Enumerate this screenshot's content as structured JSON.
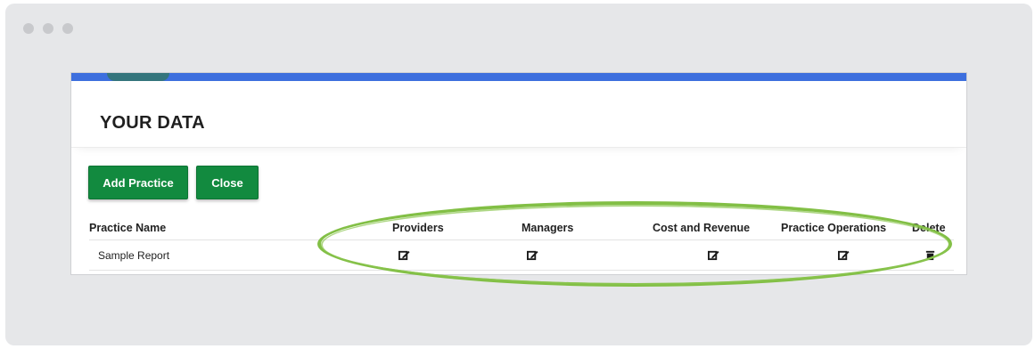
{
  "window": {
    "controls": [
      "close-dot",
      "minimize-dot",
      "zoom-dot"
    ]
  },
  "page": {
    "title": "YOUR DATA"
  },
  "actions": {
    "add_practice": "Add Practice",
    "close": "Close"
  },
  "table": {
    "headers": [
      "Practice Name",
      "Providers",
      "Managers",
      "Cost and Revenue",
      "Practice Operations",
      "Delete"
    ],
    "rows": [
      {
        "name": "Sample Report",
        "icons": [
          "edit-icon",
          "edit-icon",
          "edit-icon",
          "edit-icon",
          "delete-icon"
        ]
      }
    ]
  },
  "colors": {
    "accent_bar": "#3d6fde",
    "button": "#128a3f",
    "highlight_ring": "#82bf45",
    "frame": "#e6e7e9"
  }
}
